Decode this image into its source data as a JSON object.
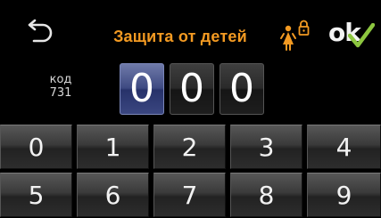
{
  "header": {
    "title": "Защита от детей",
    "ok_label": "ok",
    "back_icon": "back-arrow-icon",
    "child_lock_icon": "child-lock-icon",
    "ok_check_icon": "checkmark-icon",
    "accent_color": "#f39a22",
    "check_color": "#8cc63f"
  },
  "code": {
    "label": "код",
    "value": "731"
  },
  "digits": [
    {
      "value": "0",
      "active": true
    },
    {
      "value": "0",
      "active": false
    },
    {
      "value": "0",
      "active": false
    }
  ],
  "keypad": {
    "keys": [
      "0",
      "1",
      "2",
      "3",
      "4",
      "5",
      "6",
      "7",
      "8",
      "9"
    ]
  }
}
